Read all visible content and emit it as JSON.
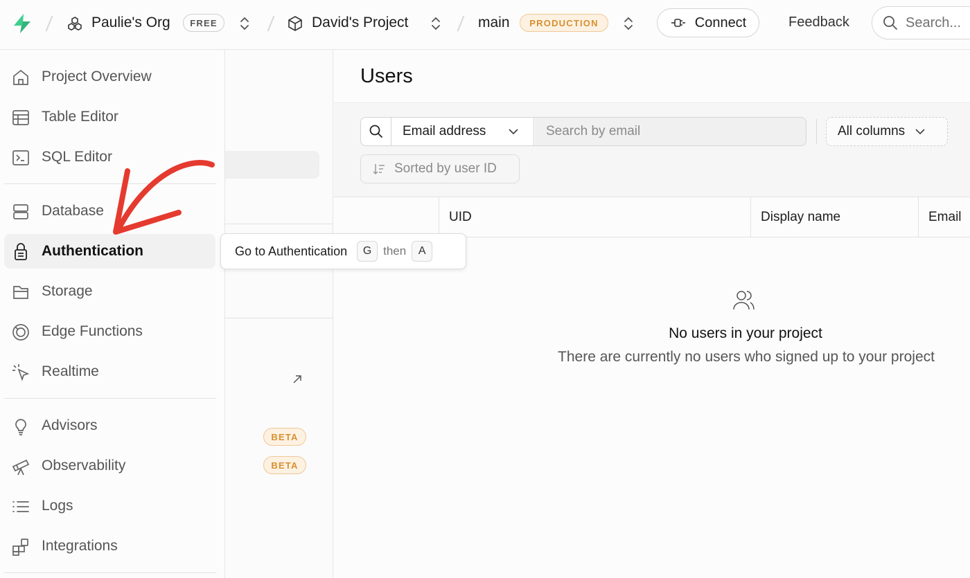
{
  "topbar": {
    "org_name": "Paulie's Org",
    "org_plan": "FREE",
    "project_name": "David's Project",
    "branch_name": "main",
    "branch_env": "PRODUCTION",
    "connect_label": "Connect",
    "feedback_label": "Feedback",
    "search_placeholder": "Search..."
  },
  "sidebar": {
    "items": [
      {
        "label": "Project Overview",
        "icon": "home-icon"
      },
      {
        "label": "Table Editor",
        "icon": "table-icon"
      },
      {
        "label": "SQL Editor",
        "icon": "terminal-icon"
      },
      {
        "label": "Database",
        "icon": "database-icon"
      },
      {
        "label": "Authentication",
        "icon": "lock-icon",
        "active": true
      },
      {
        "label": "Storage",
        "icon": "archive-icon"
      },
      {
        "label": "Edge Functions",
        "icon": "globe-icon"
      },
      {
        "label": "Realtime",
        "icon": "cursor-click-icon"
      },
      {
        "label": "Advisors",
        "icon": "lightbulb-icon"
      },
      {
        "label": "Observability",
        "icon": "telescope-icon"
      },
      {
        "label": "Logs",
        "icon": "list-icon"
      },
      {
        "label": "Integrations",
        "icon": "blocks-icon"
      }
    ]
  },
  "subpanel": {
    "badges": [
      "BETA",
      "BETA"
    ]
  },
  "tooltip": {
    "text": "Go to Authentication",
    "key1": "G",
    "then": "then",
    "key2": "A"
  },
  "main": {
    "title": "Users",
    "search_column": "Email address",
    "search_placeholder": "Search by email",
    "columns_label": "All columns",
    "sort_label": "Sorted by user ID",
    "table_headers": [
      "UID",
      "Display name",
      "Email"
    ],
    "empty_title": "No users in your project",
    "empty_subtitle": "There are currently no users who signed up to your project"
  },
  "colors": {
    "accent_green": "#3ecf8e",
    "annotation_red": "#e53a2f",
    "badge_orange": "#d7902f"
  }
}
